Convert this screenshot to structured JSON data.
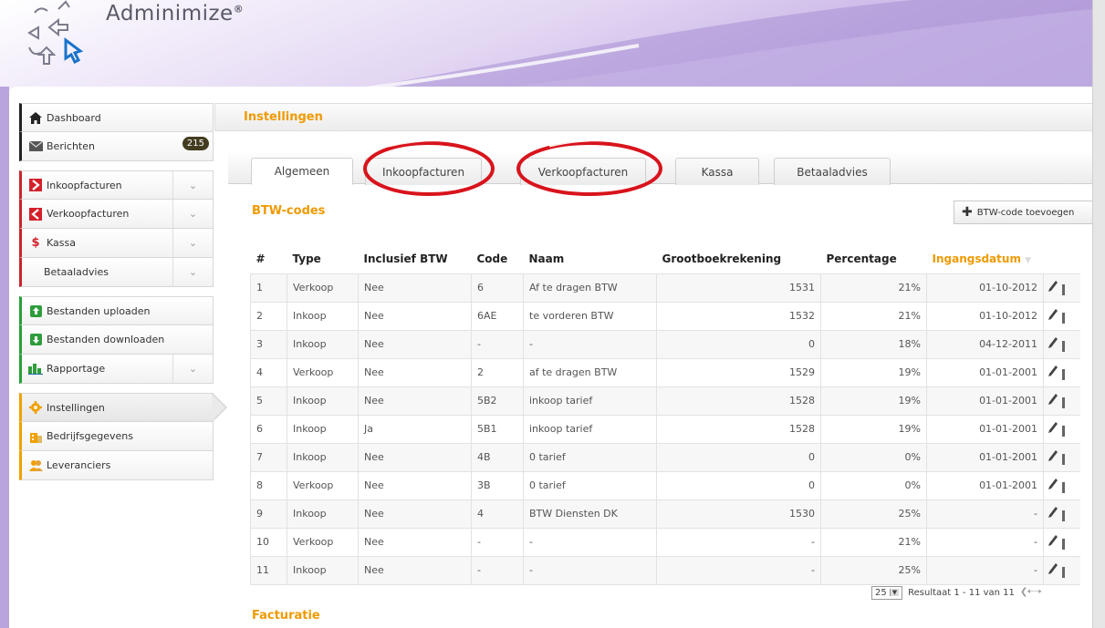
{
  "app": {
    "logo_text": "Adminimize",
    "logo_mark": "®"
  },
  "sidebar": {
    "groups": [
      {
        "items": [
          {
            "label": "Dashboard",
            "icon": "home-icon"
          },
          {
            "label": "Berichten",
            "icon": "mail-icon",
            "badge": "215"
          }
        ]
      },
      {
        "items": [
          {
            "label": "Inkoopfacturen",
            "icon": "arrow-right-red-icon"
          },
          {
            "label": "Verkoopfacturen",
            "icon": "arrow-left-red-icon"
          },
          {
            "label": "Kassa",
            "icon": "dollar-icon"
          },
          {
            "label": "Betaaladvies"
          }
        ]
      },
      {
        "items": [
          {
            "label": "Bestanden uploaden",
            "icon": "upload-icon"
          },
          {
            "label": "Bestanden downloaden",
            "icon": "download-icon"
          },
          {
            "label": "Rapportage",
            "icon": "chart-icon"
          }
        ]
      },
      {
        "items": [
          {
            "label": "Instellingen",
            "icon": "gear-icon"
          },
          {
            "label": "Bedrijfsgegevens",
            "icon": "building-icon"
          },
          {
            "label": "Leveranciers",
            "icon": "suppliers-icon"
          }
        ]
      }
    ]
  },
  "main": {
    "page_title": "Instellingen",
    "tabs": [
      "Algemeen",
      "Inkoopfacturen",
      "Verkoopfacturen",
      "Kassa",
      "Betaaladvies"
    ],
    "active_tab": "Algemeen",
    "section_btw": "BTW-codes",
    "add_button": "BTW-code toevoegen",
    "columns": [
      "#",
      "Type",
      "Inclusief BTW",
      "Code",
      "Naam",
      "Grootboekrekening",
      "Percentage",
      "Ingangsdatum"
    ],
    "rows": [
      [
        "1",
        "Verkoop",
        "Nee",
        "6",
        "Af te dragen BTW",
        "1531",
        "21%",
        "01-10-2012"
      ],
      [
        "2",
        "Inkoop",
        "Nee",
        "6AE",
        "te vorderen BTW",
        "1532",
        "21%",
        "01-10-2012"
      ],
      [
        "3",
        "Inkoop",
        "Nee",
        "-",
        "-",
        "0",
        "18%",
        "04-12-2011"
      ],
      [
        "4",
        "Verkoop",
        "Nee",
        "2",
        "af te dragen BTW",
        "1529",
        "19%",
        "01-01-2001"
      ],
      [
        "5",
        "Inkoop",
        "Nee",
        "5B2",
        "inkoop tarief",
        "1528",
        "19%",
        "01-01-2001"
      ],
      [
        "6",
        "Inkoop",
        "Ja",
        "5B1",
        "inkoop tarief",
        "1528",
        "19%",
        "01-01-2001"
      ],
      [
        "7",
        "Inkoop",
        "Nee",
        "4B",
        "0 tarief",
        "0",
        "0%",
        "01-01-2001"
      ],
      [
        "8",
        "Verkoop",
        "Nee",
        "3B",
        "0 tarief",
        "0",
        "0%",
        "01-01-2001"
      ],
      [
        "9",
        "Inkoop",
        "Nee",
        "4",
        "BTW Diensten DK",
        "1530",
        "25%",
        "-"
      ],
      [
        "10",
        "Verkoop",
        "Nee",
        "-",
        "-",
        "-",
        "21%",
        "-"
      ],
      [
        "11",
        "Inkoop",
        "Nee",
        "-",
        "-",
        "-",
        "25%",
        "-"
      ]
    ],
    "pager": {
      "page_size": "25",
      "result_text": "Resultaat 1 - 11 van 11"
    },
    "section_facturatie": "Facturatie"
  },
  "colors": {
    "accent_orange": "#ef9a00",
    "highlight_red": "#d8141c",
    "header_purple": "#b79fdc"
  }
}
